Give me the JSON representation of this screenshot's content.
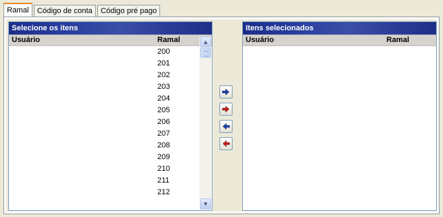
{
  "tabs": [
    {
      "label": "Ramal",
      "active": true
    },
    {
      "label": "Código de conta",
      "active": false
    },
    {
      "label": "Código pré pago",
      "active": false
    }
  ],
  "left_panel": {
    "title": "Selecione os itens",
    "columns": {
      "user": "Usuário",
      "ramal": "Ramal"
    },
    "rows": [
      {
        "user": "",
        "ramal": "200"
      },
      {
        "user": "",
        "ramal": "201"
      },
      {
        "user": "",
        "ramal": "202"
      },
      {
        "user": "",
        "ramal": "203"
      },
      {
        "user": "",
        "ramal": "204"
      },
      {
        "user": "",
        "ramal": "205"
      },
      {
        "user": "",
        "ramal": "206"
      },
      {
        "user": "",
        "ramal": "207"
      },
      {
        "user": "",
        "ramal": "208"
      },
      {
        "user": "",
        "ramal": "209"
      },
      {
        "user": "",
        "ramal": "210"
      },
      {
        "user": "",
        "ramal": "211"
      },
      {
        "user": "",
        "ramal": "212"
      }
    ]
  },
  "right_panel": {
    "title": "Itens selecionados",
    "columns": {
      "user": "Usuário",
      "ramal": "Ramal"
    },
    "rows": []
  },
  "move_buttons": [
    {
      "name": "move-right-button",
      "icon": "arrow-right-icon",
      "color": "#1a3fb8",
      "direction": "right"
    },
    {
      "name": "move-all-right-button",
      "icon": "double-arrow-right-icon",
      "color": "#d01818",
      "direction": "right"
    },
    {
      "name": "move-left-button",
      "icon": "arrow-left-icon",
      "color": "#1a3fb8",
      "direction": "left"
    },
    {
      "name": "move-all-left-button",
      "icon": "double-arrow-left-icon",
      "color": "#d01818",
      "direction": "left"
    }
  ],
  "colors": {
    "header_gradient": "#2a3f9e",
    "active_tab_accent": "#e68b2c",
    "panel_border": "#7f9db9"
  }
}
